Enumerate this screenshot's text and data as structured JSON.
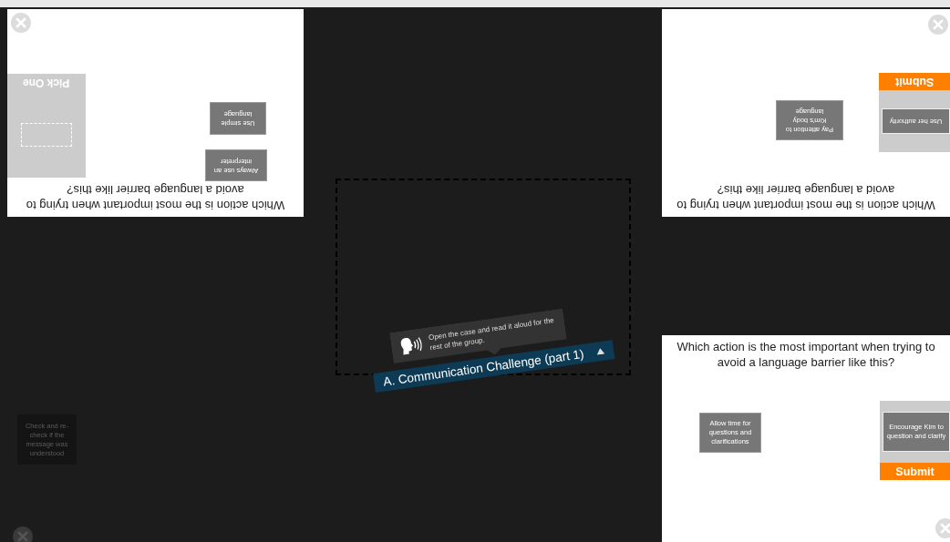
{
  "panels": [
    {
      "upside_down": true,
      "question": "Which action is the most important when trying to avoid a language barrier like this?",
      "options": [
        "Use simple language",
        "Always use an interpreter"
      ],
      "dropzone": {
        "kind": "pick",
        "label": "Pick One"
      }
    },
    {
      "upside_down": true,
      "question": "Which action is the most important when trying to avoid a language barrier like this?",
      "options": [
        "Pay attention to Kim's body language"
      ],
      "dropzone": {
        "kind": "submit",
        "label": "Submit",
        "placed": "Use her authority"
      }
    },
    {
      "upside_down": false,
      "question": "Which action is the most important when trying to avoid a language barrier like this?",
      "options": [
        "Allow time for questions and clarifications"
      ],
      "dropzone": {
        "kind": "submit",
        "label": "Submit",
        "placed": "Encourage Kim to question and clarify"
      }
    }
  ],
  "ghost": {
    "text": "Check and re-check if the message was understood",
    "dimmed": true
  },
  "instruction": "Open the case and read it aloud for the rest of the group.",
  "case_title": "A. Communication Challenge (part 1)"
}
